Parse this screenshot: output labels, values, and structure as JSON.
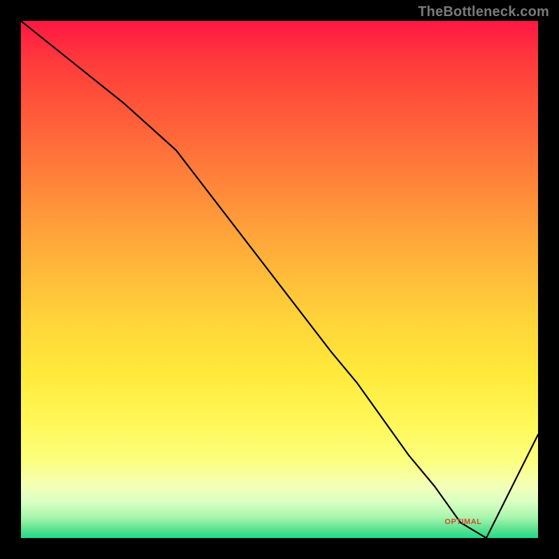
{
  "watermark": "TheBottleneck.com",
  "optimal_label": "OPTIMAL",
  "chart_data": {
    "type": "line",
    "title": "",
    "xlabel": "",
    "ylabel": "",
    "xlim": [
      0,
      100
    ],
    "ylim": [
      0,
      100
    ],
    "x": [
      0,
      10,
      20,
      30,
      40,
      50,
      60,
      65,
      70,
      75,
      80,
      85,
      90,
      95,
      100
    ],
    "values": [
      100,
      92,
      84,
      75,
      62,
      49,
      36,
      30,
      23,
      16,
      10,
      3,
      0,
      10,
      20
    ],
    "annotations": [
      {
        "text": "OPTIMAL",
        "x_range": [
          80,
          92
        ],
        "y": 2
      }
    ],
    "gradient_scale_note": "vertical gradient from red (high bottleneck) through orange/yellow to green (optimal, low bottleneck)"
  }
}
